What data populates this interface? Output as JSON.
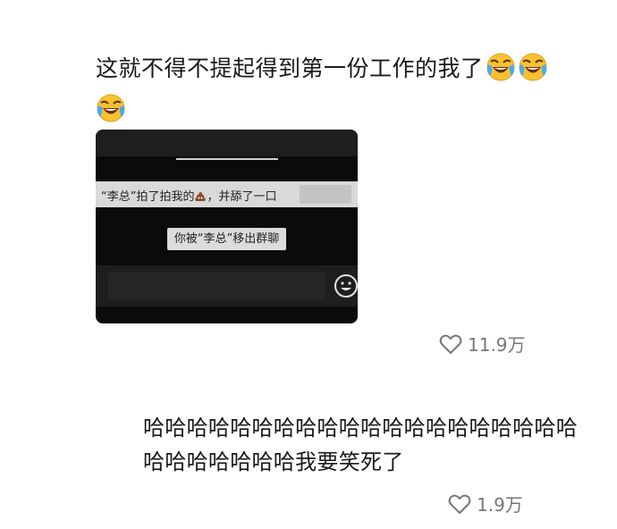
{
  "post": {
    "text": "这就不得不提起得到第一份工作的我了",
    "emoji_icons": [
      "laughing-tears-icon",
      "laughing-tears-icon",
      "laughing-tears-icon"
    ],
    "like_count": "11.9万"
  },
  "screenshot": {
    "notice_prefix": "“李总”拍了拍我的",
    "notice_emoji": "poop-icon",
    "notice_suffix": "，并舔了一口",
    "removed_notice": "你被“李总”移出群聊",
    "input_emoji": "smiley-icon"
  },
  "reply": {
    "text": "哈哈哈哈哈哈哈哈哈哈哈哈哈哈哈哈哈哈哈哈哈哈哈哈哈哈哈我要笑死了",
    "like_count": "1.9万"
  },
  "colors": {
    "text": "#1a1a1a",
    "muted": "#777777",
    "screenshot_bg": "#0b0b0b"
  }
}
